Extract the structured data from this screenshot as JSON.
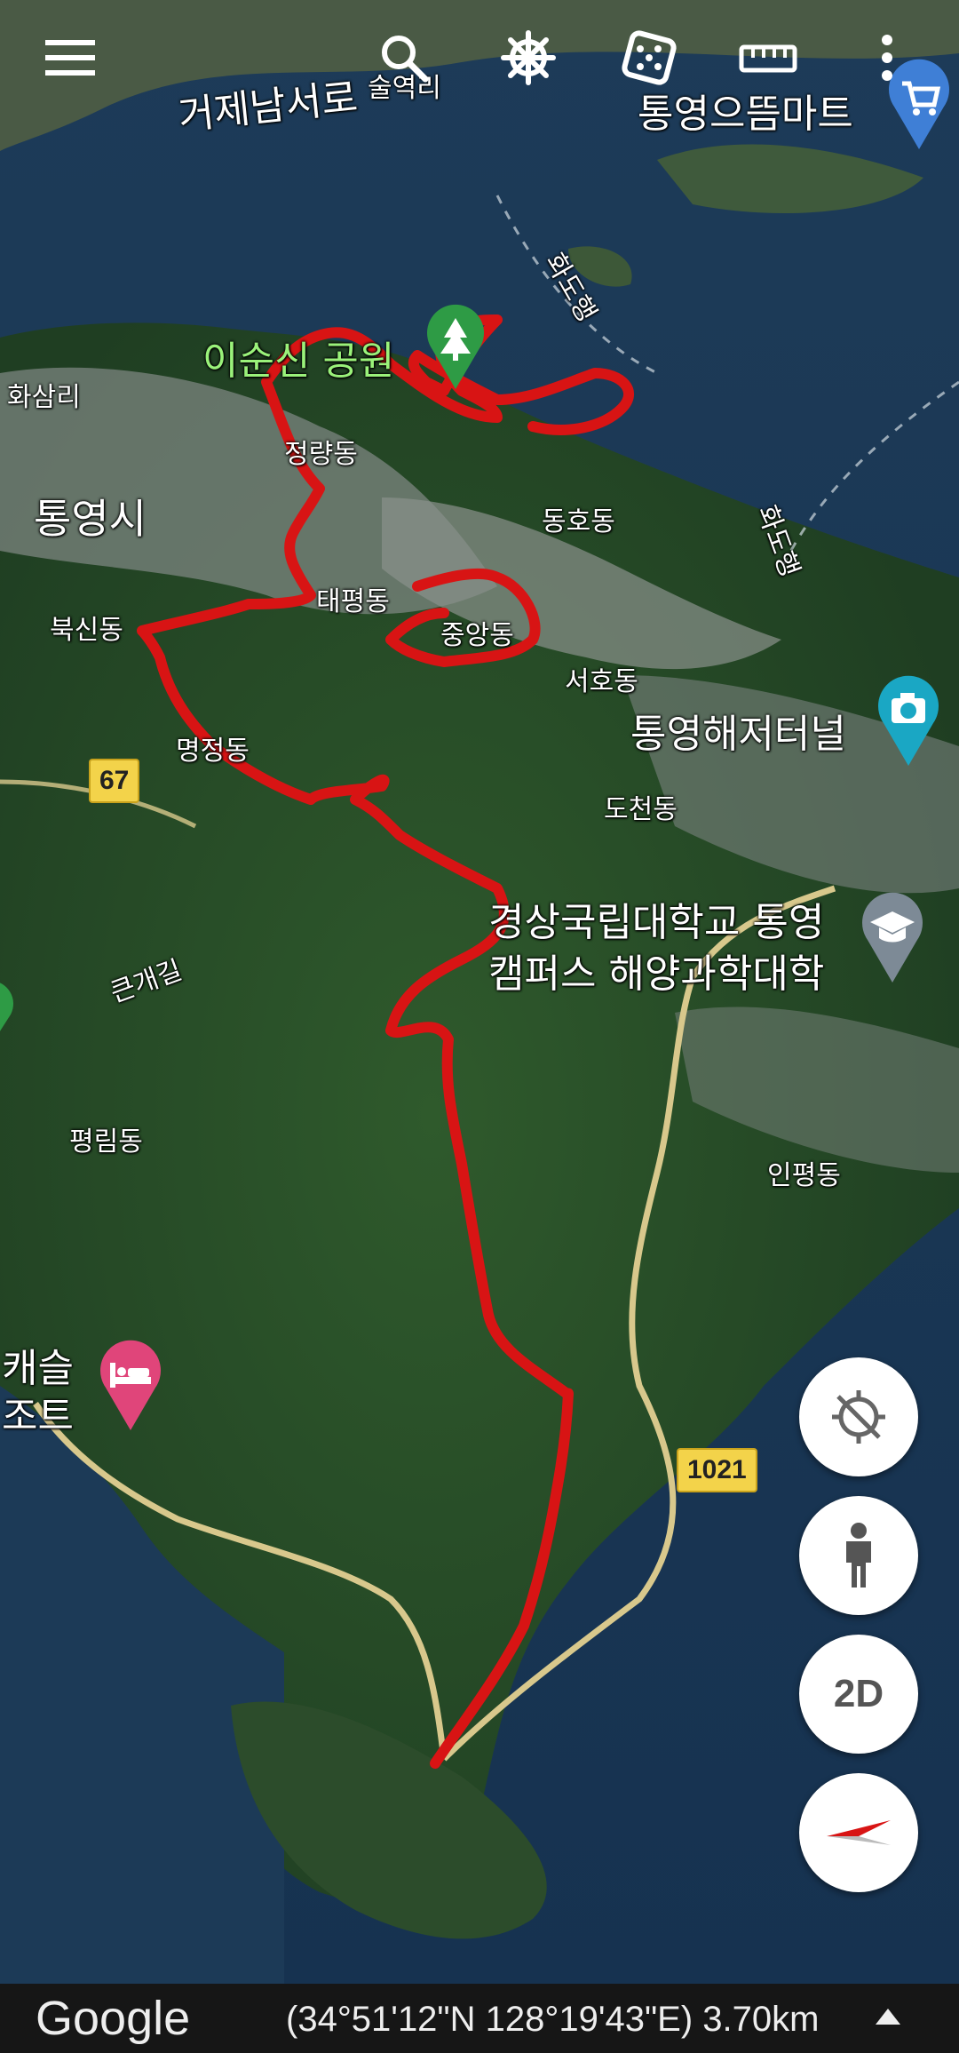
{
  "map": {
    "labels": {
      "geoje_road": "거제남서로",
      "suljeok_ri": "술역리",
      "emart": "통영으뜸마트",
      "hwado_1": "화도행",
      "hwado_2": "화도행",
      "yi_sunsin_park": "이순신 공원",
      "hwasam_ri": "화삼리",
      "jeongnyang": "정량동",
      "tongyeong_si": "통영시",
      "dongho": "동호동",
      "taepyeong": "태평동",
      "jungang": "중앙동",
      "buksin": "북신동",
      "seoho": "서호동",
      "haejeo_tunnel": "통영해저터널",
      "myeongjeong": "명정동",
      "docheon": "도천동",
      "university_1": "경상국립대학교 통영",
      "university_2": "캠퍼스 해양과학대학",
      "keungaegil": "큰개길",
      "pyeongnim": "평림동",
      "inpyeong": "인평동",
      "resort_1": "캐슬",
      "resort_2": "조트"
    },
    "road_shields": {
      "route_67": "67",
      "route_1021": "1021"
    },
    "colors": {
      "route": "#d81414",
      "road": "#d8c88c",
      "park_pin": "#2e9b45",
      "camera_pin": "#1aa7c4",
      "edu_pin": "#7d8a96",
      "hotel_pin": "#e0457a",
      "shop_pin": "#3f7fd6"
    }
  },
  "topbar": {
    "icons": [
      "menu-icon",
      "search-icon",
      "ship-wheel-icon",
      "dice-icon",
      "ruler-icon",
      "more-vert-icon"
    ]
  },
  "fabs": {
    "twod_label": "2D"
  },
  "bottombar": {
    "logo": "Google",
    "coords": "(34°51'12\"N 128°19'43\"E) 3.70km"
  }
}
